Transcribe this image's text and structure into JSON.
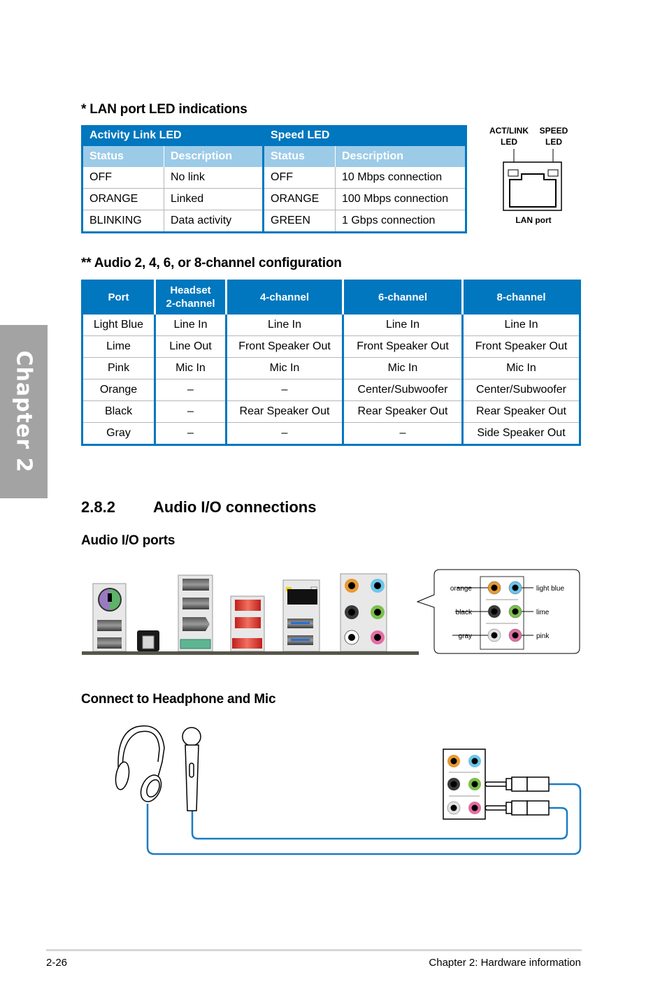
{
  "chapter_tab": "Chapter 2",
  "lan_section": {
    "title": "* LAN port LED indications",
    "group_headers": [
      "Activity Link LED",
      "Speed LED"
    ],
    "sub_headers": [
      "Status",
      "Description",
      "Status",
      "Description"
    ],
    "rows": [
      [
        "OFF",
        "No link",
        "OFF",
        "10 Mbps connection"
      ],
      [
        "ORANGE",
        "Linked",
        "ORANGE",
        "100 Mbps connection"
      ],
      [
        "BLINKING",
        "Data activity",
        "GREEN",
        "1 Gbps connection"
      ]
    ],
    "diagram": {
      "act_link_label_1": "ACT/LINK",
      "act_link_label_2": "LED",
      "speed_label_1": "SPEED",
      "speed_label_2": "LED",
      "port_label": "LAN port"
    }
  },
  "audio_section": {
    "title": "** Audio 2, 4, 6, or 8-channel configuration",
    "headers": [
      "Port",
      "Headset",
      "2-channel",
      "4-channel",
      "6-channel",
      "8-channel"
    ],
    "rows": [
      [
        "Light Blue",
        "Line In",
        "Line In",
        "Line In",
        "Line In"
      ],
      [
        "Lime",
        "Line Out",
        "Front Speaker Out",
        "Front Speaker Out",
        "Front Speaker Out"
      ],
      [
        "Pink",
        "Mic In",
        "Mic In",
        "Mic In",
        "Mic In"
      ],
      [
        "Orange",
        "–",
        "–",
        "Center/Subwoofer",
        "Center/Subwoofer"
      ],
      [
        "Black",
        "–",
        "Rear Speaker Out",
        "Rear Speaker Out",
        "Rear Speaker Out"
      ],
      [
        "Gray",
        "–",
        "–",
        "–",
        "Side Speaker Out"
      ]
    ]
  },
  "section": {
    "number": "2.8.2",
    "title": "Audio I/O connections",
    "ports_heading": "Audio I/O ports",
    "callout_labels": {
      "orange": "orange",
      "light_blue": "light blue",
      "black": "black",
      "lime": "lime",
      "gray": "gray",
      "pink": "pink"
    },
    "connect_heading": "Connect to Headphone and Mic"
  },
  "colors": {
    "table_blue": "#0077be",
    "table_subheader": "#9ccbe8",
    "jack_orange": "#e89a33",
    "jack_light_blue": "#6cc6ea",
    "jack_black": "#3a3a3a",
    "jack_lime": "#7cc04a",
    "jack_gray": "#e3e3e3",
    "jack_pink": "#e46ea4",
    "cable_blue": "#1a7cc4"
  },
  "footer": {
    "page_number": "2-26",
    "chapter": "Chapter 2: Hardware information"
  }
}
